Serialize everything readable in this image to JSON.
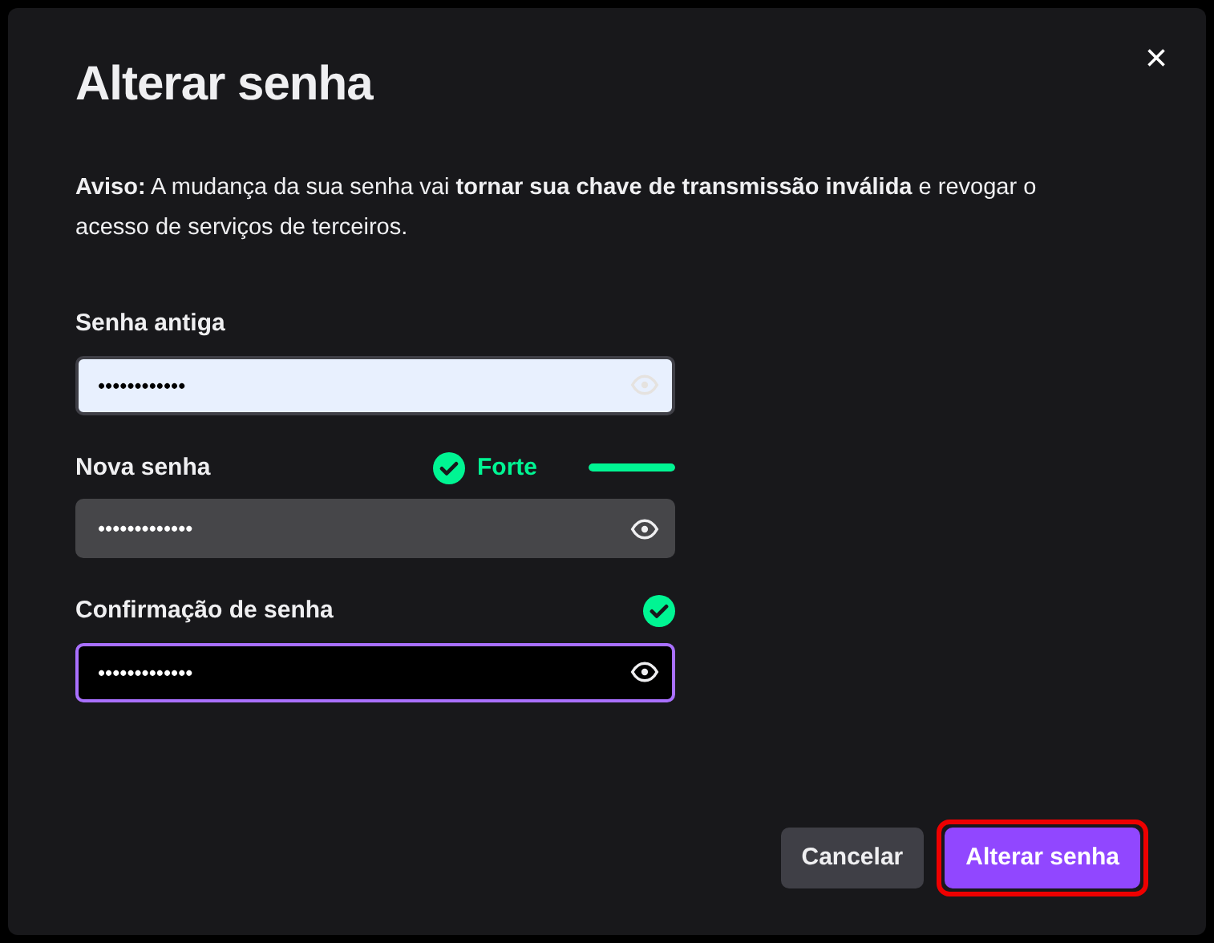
{
  "dialog": {
    "title": "Alterar senha",
    "close": "×",
    "warning": "**Aviso:** A mudança da sua senha vai **tornar sua chave de transmissão inválida** e revogar o acesso de serviços de terceiros.",
    "fields": [
      {
        "label": "Senha antiga",
        "value": "••••••••••••",
        "autofilled": true,
        "focused": false
      },
      {
        "label": "Nova senha",
        "value": "•••••••••••••",
        "autofilled": false,
        "focused": false,
        "valid": true,
        "strength": {
          "text": "Forte",
          "level": 1
        }
      },
      {
        "label": "Confirmação de senha",
        "value": "•••••••••••••",
        "autofilled": false,
        "focused": true,
        "valid": true
      }
    ],
    "buttons": [
      {
        "label": "Cancelar",
        "kind": "secondary",
        "highlighted": false
      },
      {
        "label": "Alterar senha",
        "kind": "primary",
        "highlighted": true
      }
    ]
  }
}
